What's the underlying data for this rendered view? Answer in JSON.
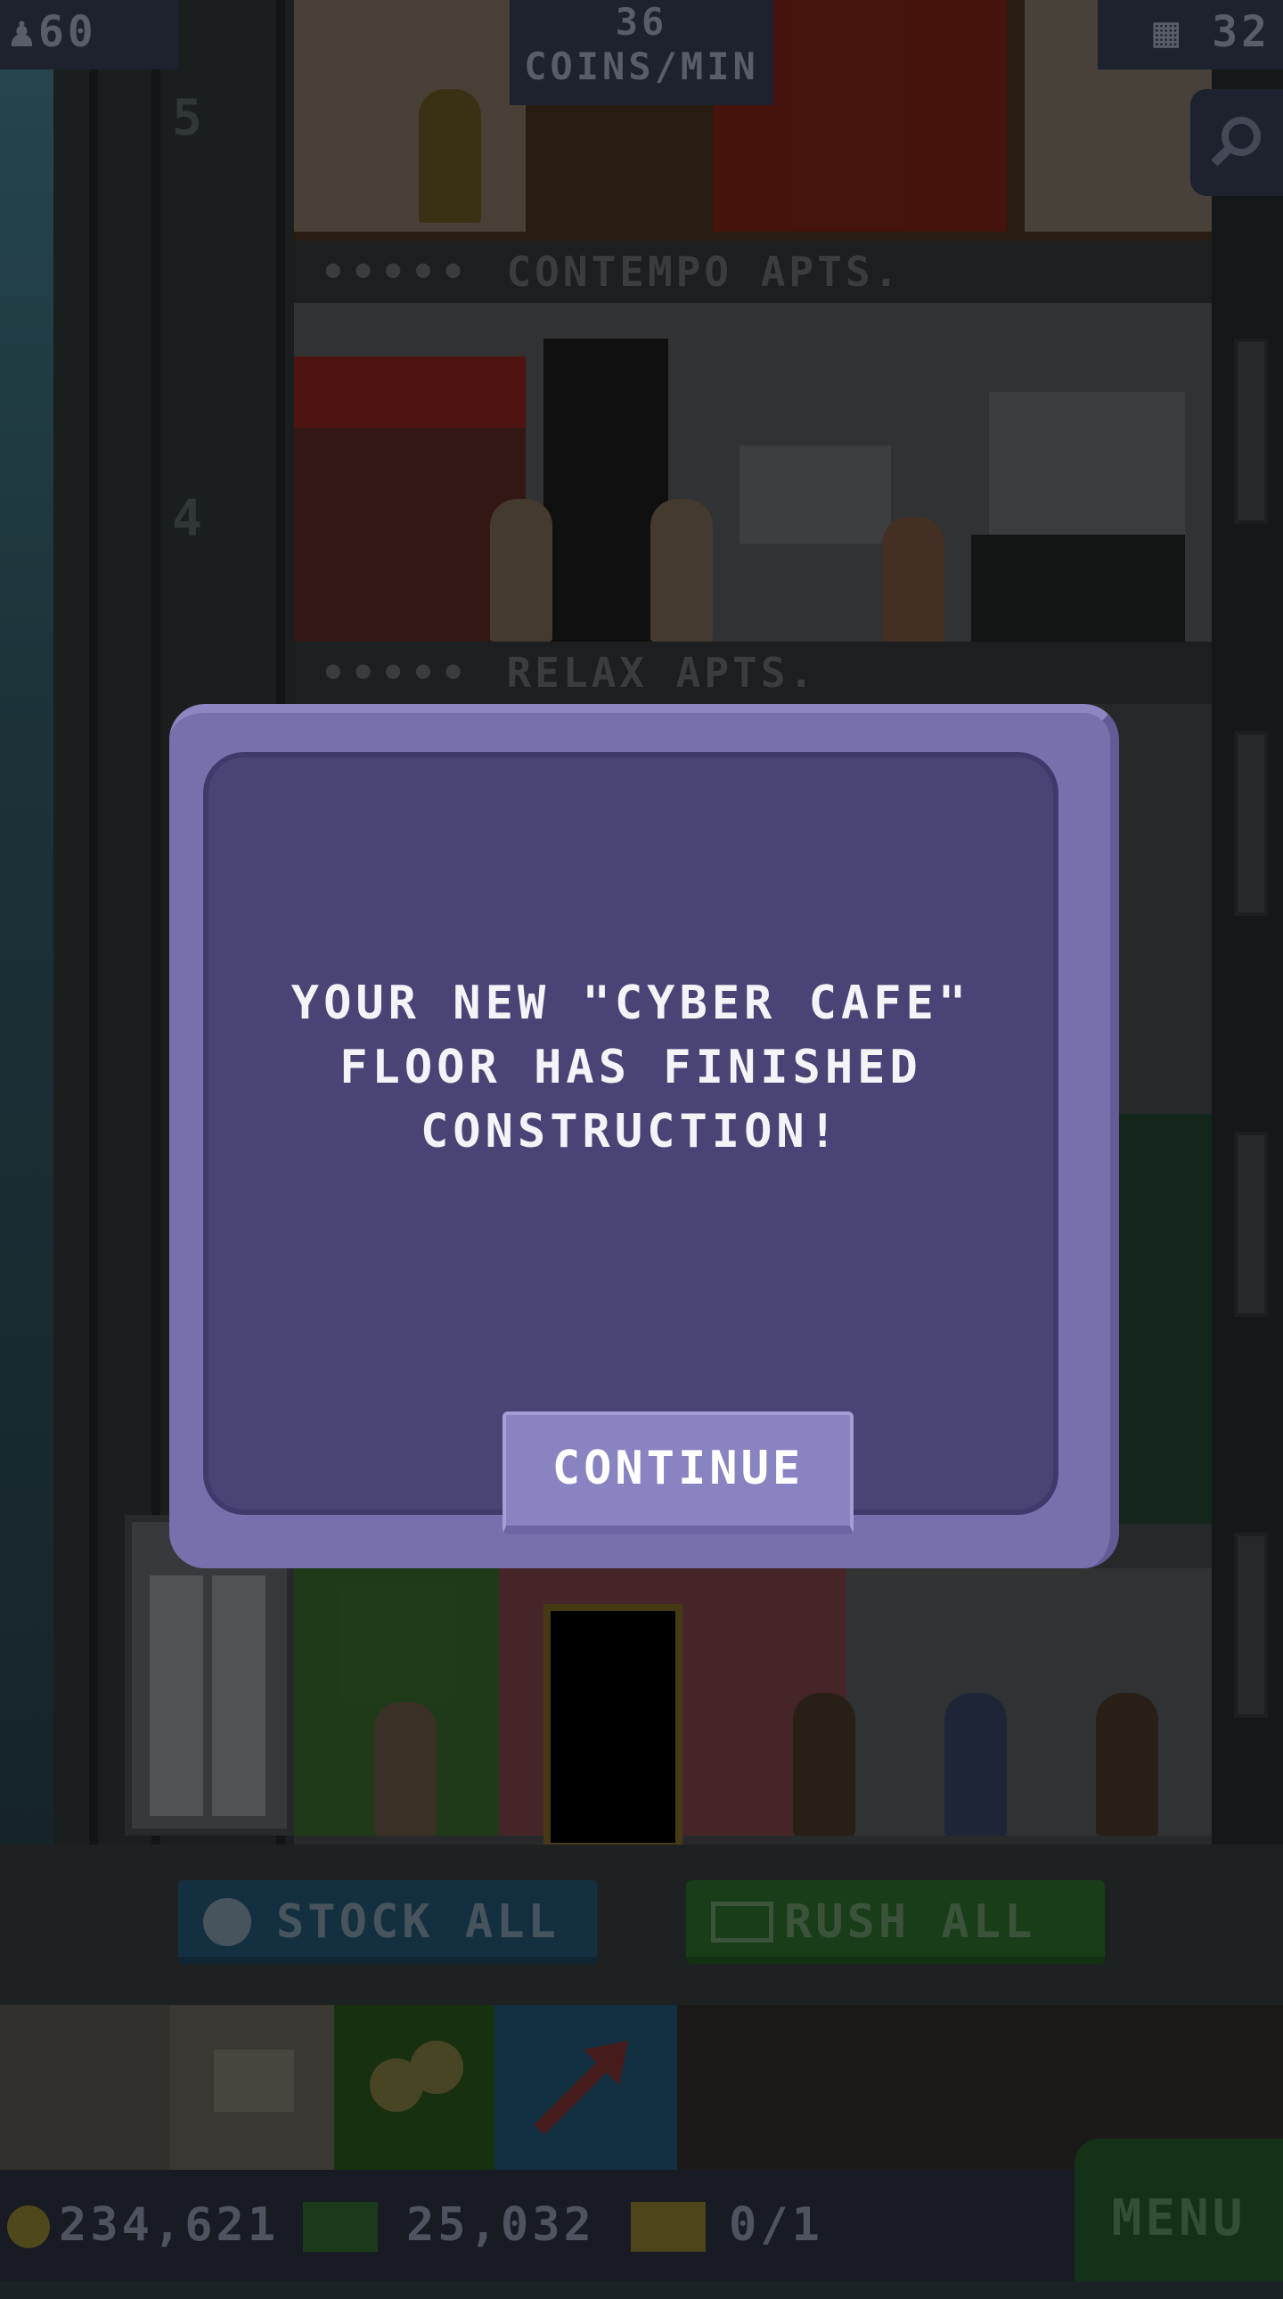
{
  "hud": {
    "population": "60",
    "coins_per_min_value": "36",
    "coins_per_min_label": "COINS/MIN",
    "floor_count": "32"
  },
  "tower": {
    "floor_numbers": [
      "5",
      "4"
    ],
    "floors": [
      {
        "name": "CONTEMPO APTS.",
        "residents": "•••••"
      },
      {
        "name": "RELAX APTS.",
        "residents": "•••••"
      }
    ]
  },
  "actions": {
    "stock_all": "STOCK ALL",
    "rush_all": "RUSH ALL"
  },
  "footer": {
    "coins": "234,621",
    "bux": "25,032",
    "tickets": "0/1",
    "menu": "MENU"
  },
  "dialog": {
    "message": "YOUR NEW \"CYBER CAFE\" FLOOR HAS FINISHED CONSTRUCTION!",
    "button": "CONTINUE"
  },
  "colors": {
    "dialog_frame": "#7870ad",
    "dialog_body": "#4a4476",
    "button": "#8a83c2",
    "stock_button": "#1f4a63",
    "rush_button": "#275e27",
    "menu_button": "#1f4d24"
  }
}
